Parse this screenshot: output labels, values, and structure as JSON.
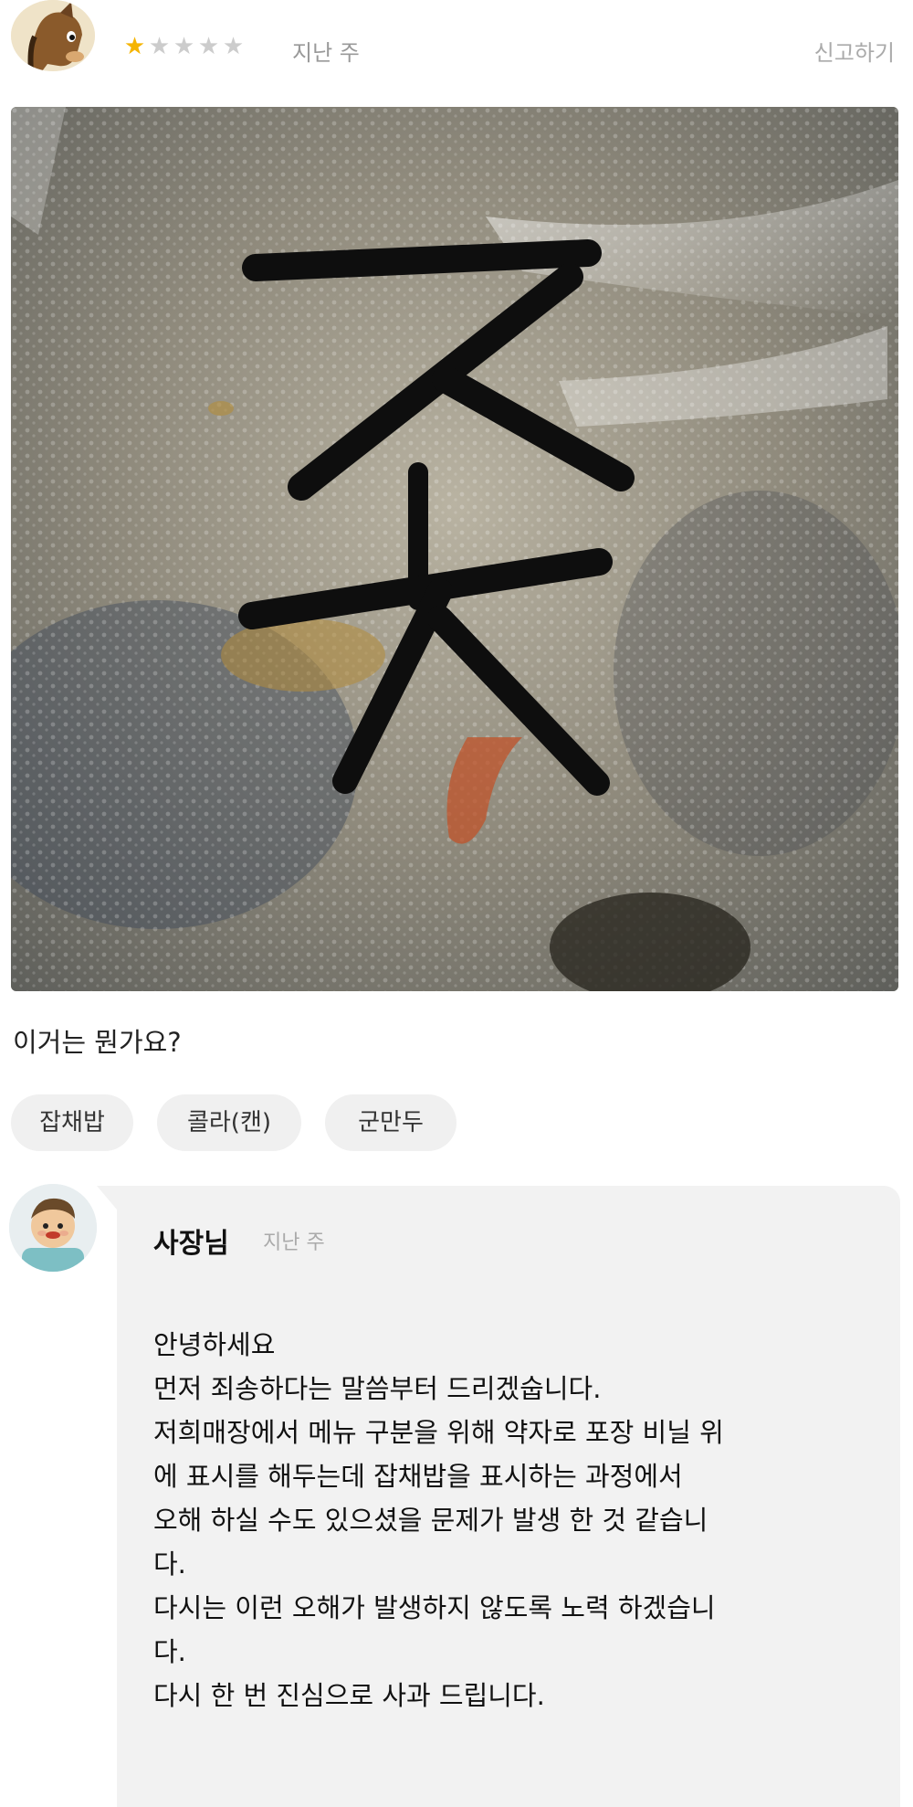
{
  "review": {
    "rating": 1,
    "max_rating": 5,
    "date": "지난 주",
    "report_label": "신고하기",
    "text": "이거는 뭔가요?",
    "menu_tags": [
      "잡채밥",
      "콜라(캔)",
      "군만두"
    ]
  },
  "reply": {
    "name": "사장님",
    "date": "지난 주",
    "lines": [
      "안녕하세요",
      "먼저 죄송하다는 말씀부터 드리겠숩니다.",
      "저희매장에서 메뉴 구분을 위해 약자로 포장 비닐 위",
      "에 표시를 해두는데 잡채밥을 표시하는 과정에서",
      "오해 하실 수도 있으셨을  문제가 발생 한 것 같습니",
      "다.",
      "다시는 이런 오해가 발생하지 않도록 노력 하겠습니",
      "다.",
      "다시 한 번 진심으로 사과 드립니다."
    ]
  },
  "photo": {
    "marker_text": "ㅈㅊ"
  },
  "colors": {
    "star_on": "#f5b400",
    "star_off": "#cccccc",
    "tag_bg": "#f0f0f0",
    "bubble_bg": "#f2f2f2"
  }
}
